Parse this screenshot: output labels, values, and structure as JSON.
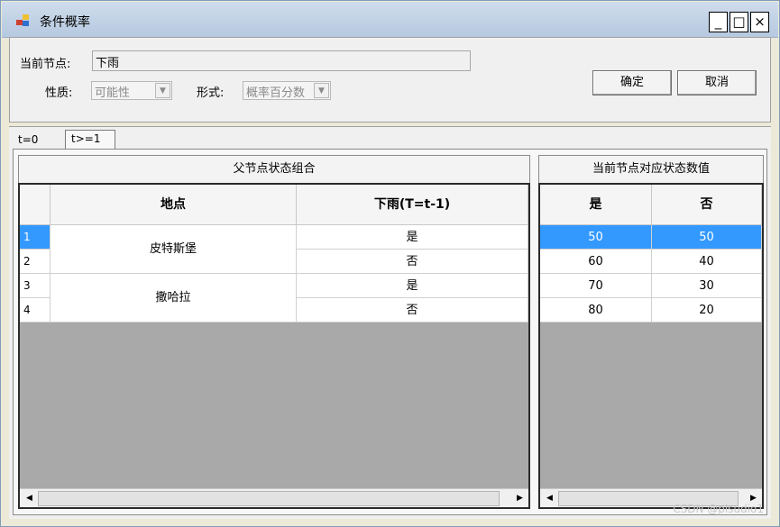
{
  "window": {
    "title": "条件概率",
    "minimize": "_",
    "maximize": "□",
    "close": "×"
  },
  "form": {
    "current_node_label": "当前节点:",
    "current_node_value": "下雨",
    "nature_label": "性质:",
    "nature_value": "可能性",
    "format_label": "形式:",
    "format_value": "概率百分数",
    "ok_label": "确定",
    "cancel_label": "取消"
  },
  "tabs": [
    {
      "label": "t=0",
      "selected": false
    },
    {
      "label": "t>=1",
      "selected": true
    }
  ],
  "parent_grid": {
    "group_title": "父节点状态组合",
    "columns": [
      "地点",
      "下雨(T=t-1)"
    ],
    "row_numbers": [
      "1",
      "2",
      "3",
      "4"
    ],
    "locations": [
      "皮特斯堡",
      "撒哈拉"
    ],
    "rain_values": [
      "是",
      "否",
      "是",
      "否"
    ]
  },
  "value_grid": {
    "group_title": "当前节点对应状态数值",
    "columns": [
      "是",
      "否"
    ],
    "rows": [
      [
        "50",
        "50"
      ],
      [
        "60",
        "40"
      ],
      [
        "70",
        "30"
      ],
      [
        "80",
        "20"
      ]
    ],
    "selected_row": 0
  },
  "watermark": "CSDN @pisudio1",
  "colors": {
    "selection": "#3399ff",
    "empty_grid_area": "#a9a9a9"
  }
}
